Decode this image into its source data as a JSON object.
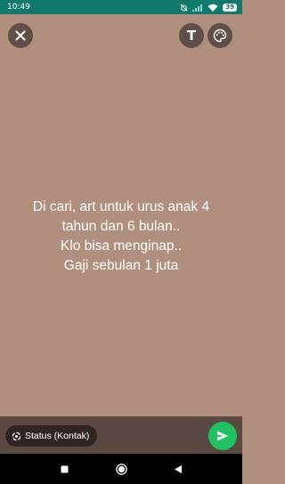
{
  "status_bar": {
    "time": "10:49",
    "battery": "39",
    "icons": [
      "alarm-off-icon",
      "signal-icon",
      "wifi-icon",
      "battery-icon"
    ]
  },
  "toolbar": {
    "close_icon": "close-icon",
    "text_label": "T",
    "palette_icon": "palette-icon"
  },
  "status": {
    "background_color": "#b08f7e",
    "lines": [
      "Di cari, art untuk urus anak 4",
      "tahun dan 6 bulan..",
      "Klo bisa menginap..",
      "Gaji sebulan 1 juta"
    ]
  },
  "bottom": {
    "audience_label": "Status (Kontak)",
    "send_icon": "send-icon"
  },
  "nav": {
    "buttons": [
      "recents-icon",
      "home-icon",
      "back-icon"
    ]
  },
  "colors": {
    "status_bar": "#0f7a6c",
    "send_button": "#21c063",
    "bottom_bar": "#5a4843"
  }
}
